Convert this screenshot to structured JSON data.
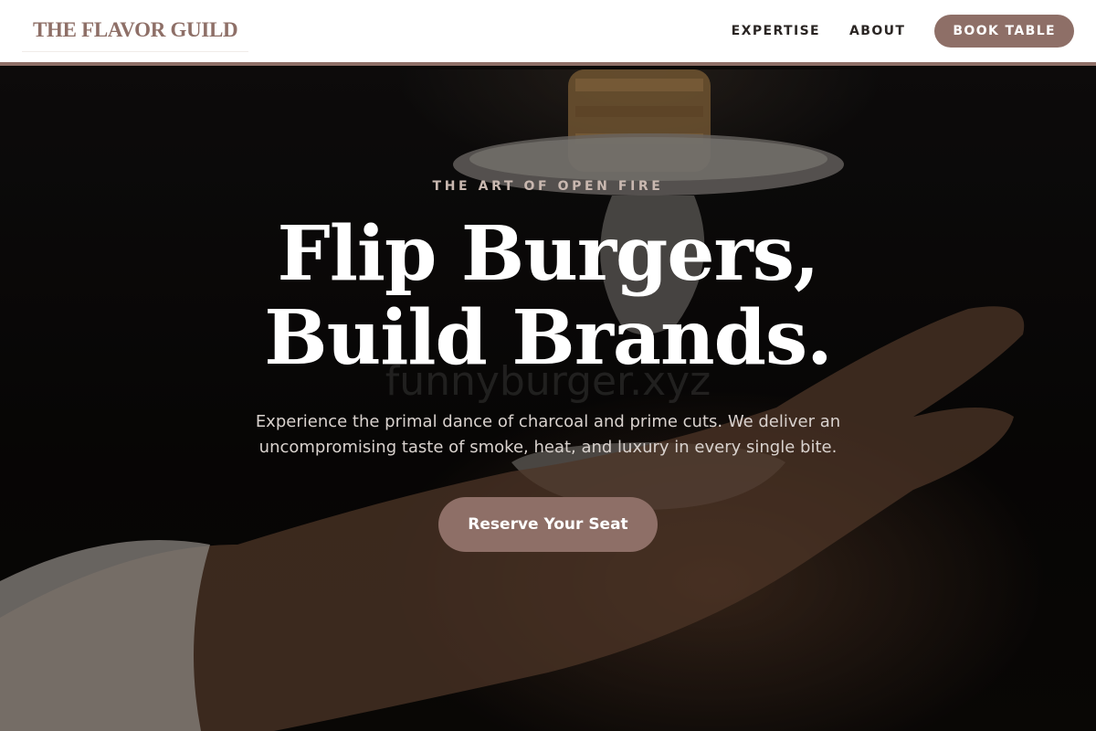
{
  "header": {
    "logo": "THE FLAVOR GUILD",
    "nav": [
      {
        "label": "EXPERTISE"
      },
      {
        "label": "ABOUT"
      }
    ],
    "book_button": "BOOK TABLE"
  },
  "hero": {
    "eyebrow": "THE ART OF OPEN FIRE",
    "headline_line1": "Flip Burgers,",
    "headline_line2": "Build Brands.",
    "subtext": "Experience the primal dance of charcoal and prime cuts. We deliver an uncompromising taste of smoke, heat, and luxury in every single bite.",
    "cta": "Reserve Your Seat",
    "watermark": "funnyburger.xyz"
  },
  "colors": {
    "accent": "#8e6f67",
    "header_bg": "#ffffff",
    "hero_bg": "#0b0908",
    "headline": "#ffffff"
  }
}
